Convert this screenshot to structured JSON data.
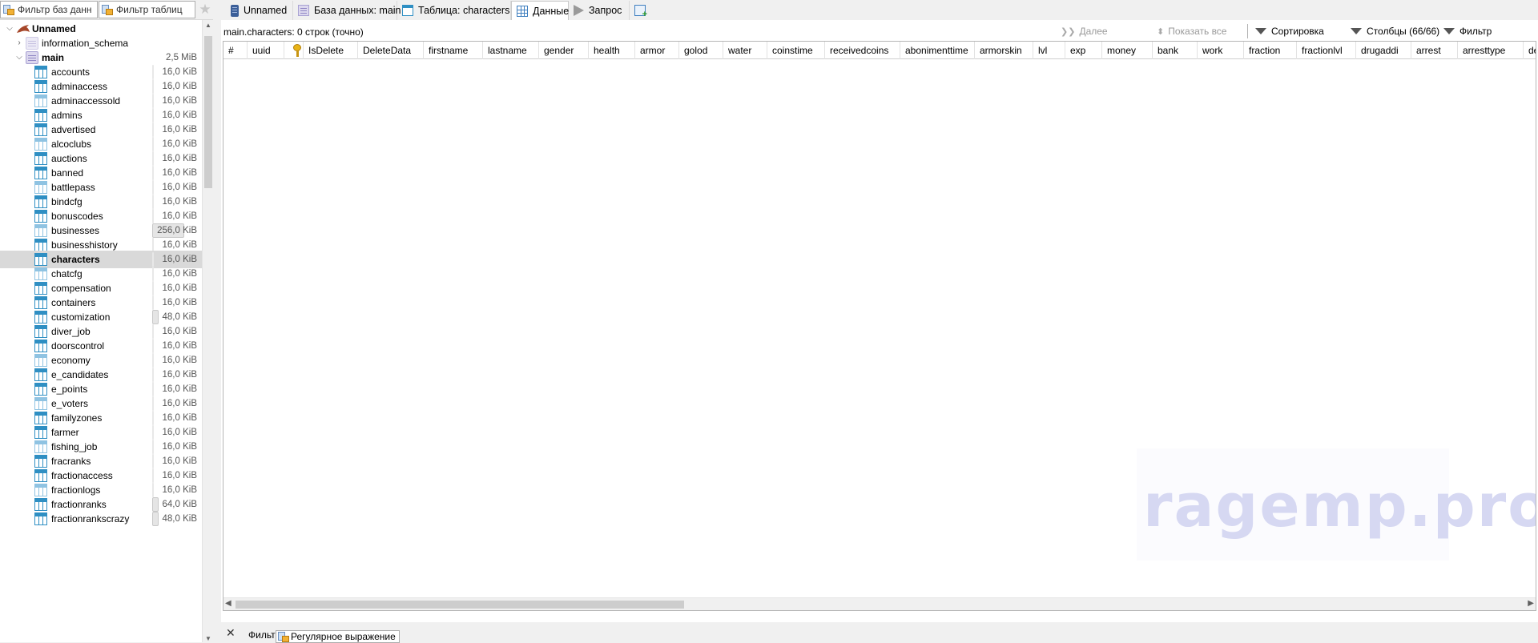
{
  "left_panel": {
    "db_filter_label": "Фильтр баз данн",
    "table_filter_label": "Фильтр таблиц",
    "server": "Unnamed",
    "databases": [
      {
        "name": "information_schema",
        "expanded": false
      },
      {
        "name": "main",
        "expanded": true,
        "size": "2,5 MiB"
      }
    ],
    "tables": [
      {
        "name": "accounts",
        "size": "16,0 KiB",
        "bar": 0.0
      },
      {
        "name": "adminaccess",
        "size": "16,0 KiB",
        "bar": 0.0
      },
      {
        "name": "adminaccessold",
        "size": "16,0 KiB",
        "bar": 0.0
      },
      {
        "name": "admins",
        "size": "16,0 KiB",
        "bar": 0.0
      },
      {
        "name": "advertised",
        "size": "16,0 KiB",
        "bar": 0.0
      },
      {
        "name": "alcoclubs",
        "size": "16,0 KiB",
        "bar": 0.0
      },
      {
        "name": "auctions",
        "size": "16,0 KiB",
        "bar": 0.0
      },
      {
        "name": "banned",
        "size": "16,0 KiB",
        "bar": 0.0
      },
      {
        "name": "battlepass",
        "size": "16,0 KiB",
        "bar": 0.0
      },
      {
        "name": "bindcfg",
        "size": "16,0 KiB",
        "bar": 0.0
      },
      {
        "name": "bonuscodes",
        "size": "16,0 KiB",
        "bar": 0.0
      },
      {
        "name": "businesses",
        "size": "256,0 KiB",
        "bar": 0.72
      },
      {
        "name": "businesshistory",
        "size": "16,0 KiB",
        "bar": 0.0
      },
      {
        "name": "characters",
        "size": "16,0 KiB",
        "bar": 0.0
      },
      {
        "name": "chatcfg",
        "size": "16,0 KiB",
        "bar": 0.0
      },
      {
        "name": "compensation",
        "size": "16,0 KiB",
        "bar": 0.0
      },
      {
        "name": "containers",
        "size": "16,0 KiB",
        "bar": 0.0
      },
      {
        "name": "customization",
        "size": "48,0 KiB",
        "bar": 0.1
      },
      {
        "name": "diver_job",
        "size": "16,0 KiB",
        "bar": 0.0
      },
      {
        "name": "doorscontrol",
        "size": "16,0 KiB",
        "bar": 0.0
      },
      {
        "name": "economy",
        "size": "16,0 KiB",
        "bar": 0.0
      },
      {
        "name": "e_candidates",
        "size": "16,0 KiB",
        "bar": 0.0
      },
      {
        "name": "e_points",
        "size": "16,0 KiB",
        "bar": 0.0
      },
      {
        "name": "e_voters",
        "size": "16,0 KiB",
        "bar": 0.0
      },
      {
        "name": "familyzones",
        "size": "16,0 KiB",
        "bar": 0.0
      },
      {
        "name": "farmer",
        "size": "16,0 KiB",
        "bar": 0.0
      },
      {
        "name": "fishing_job",
        "size": "16,0 KiB",
        "bar": 0.0
      },
      {
        "name": "fracranks",
        "size": "16,0 KiB",
        "bar": 0.0
      },
      {
        "name": "fractionaccess",
        "size": "16,0 KiB",
        "bar": 0.0
      },
      {
        "name": "fractionlogs",
        "size": "16,0 KiB",
        "bar": 0.0
      },
      {
        "name": "fractionranks",
        "size": "64,0 KiB",
        "bar": 0.14
      },
      {
        "name": "fractionrankscrazy",
        "size": "48,0 KiB",
        "bar": 0.1
      }
    ],
    "selected_table": "characters"
  },
  "tabs": [
    {
      "label": "Unnamed",
      "icon": "server-icon"
    },
    {
      "label": "База данных: main",
      "icon": "database-icon"
    },
    {
      "label": "Таблица: characters",
      "icon": "table-icon"
    },
    {
      "label": "Данные",
      "icon": "grid-icon",
      "active": true
    },
    {
      "label": "Запрос",
      "icon": "play-icon"
    },
    {
      "label": "",
      "icon": "new-query-icon"
    }
  ],
  "toolbar": {
    "row_info": "main.characters: 0 строк (точно)",
    "next_label": "Далее",
    "show_all_label": "Показать все",
    "sort_label": "Сортировка",
    "columns_label": "Столбцы (66/66)",
    "filter_label": "Фильтр"
  },
  "grid": {
    "columns": [
      "#",
      "uuid",
      "",
      "IsDelete",
      "DeleteData",
      "firstname",
      "lastname",
      "gender",
      "health",
      "armor",
      "golod",
      "water",
      "coinstime",
      "receivedcoins",
      "abonimenttime",
      "armorskin",
      "lvl",
      "exp",
      "money",
      "bank",
      "work",
      "fraction",
      "fractionlvl",
      "drugaddi",
      "arrest",
      "arresttype",
      "der"
    ],
    "key_column_icon": "key-icon",
    "rows": []
  },
  "bottom_bar": {
    "filter_label": "Фильтр",
    "regex_label": "Регулярное выражение"
  },
  "watermark": "ragemp.pro",
  "colors": {
    "selection": "#d9d9d9",
    "table_icon": "#2f8fc3",
    "watermark": "#d6d8f2"
  }
}
